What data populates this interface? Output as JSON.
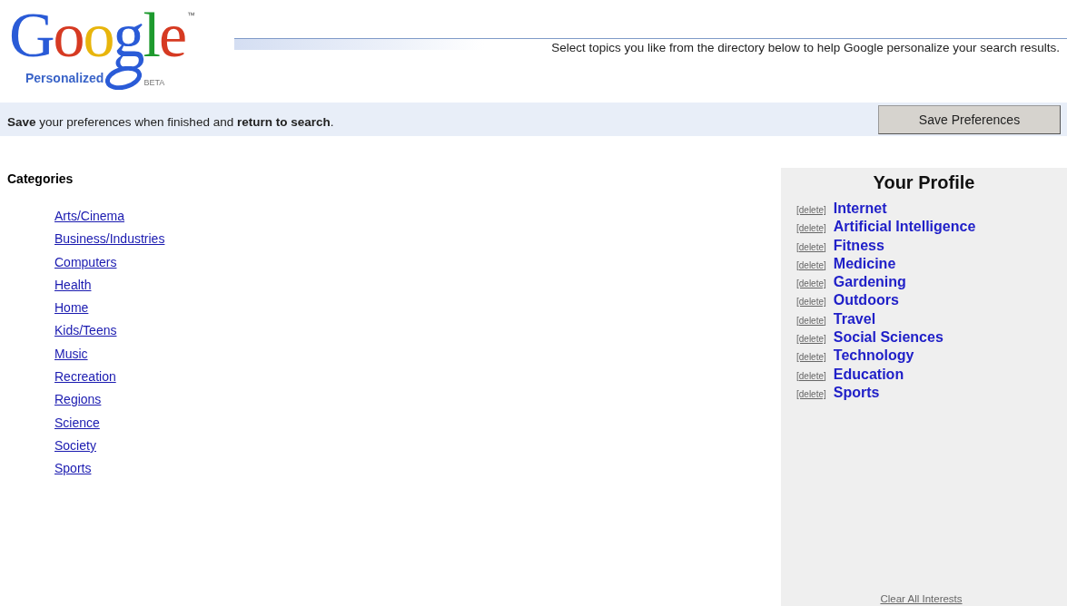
{
  "logo": {
    "wordmark": "Google",
    "trademark": "™",
    "tagline": "Personalized",
    "badge": "BETA"
  },
  "header": {
    "intro": "Select topics you like from the directory below to help Google personalize your search results."
  },
  "save_bar": {
    "message": "**Save** your preferences when finished and **return to search**.",
    "button": "Save Preferences"
  },
  "categories": {
    "title": "Categories",
    "items": [
      "Arts/Cinema",
      "Business/Industries",
      "Computers",
      "Health",
      "Home",
      "Kids/Teens",
      "Music",
      "Recreation",
      "Regions",
      "Science",
      "Society",
      "Sports"
    ]
  },
  "profile": {
    "title": "Your Profile",
    "interests": [
      {
        "delete": "[delete]",
        "name": "Internet"
      },
      {
        "delete": "[delete]",
        "name": "Artificial Intelligence"
      },
      {
        "delete": "[delete]",
        "name": "Fitness"
      },
      {
        "delete": "[delete]",
        "name": "Medicine"
      },
      {
        "delete": "[delete]",
        "name": "Gardening"
      },
      {
        "delete": "[delete]",
        "name": "Outdoors"
      },
      {
        "delete": "[delete]",
        "name": "Travel"
      },
      {
        "delete": "[delete]",
        "name": "Social Sciences"
      },
      {
        "delete": "[delete]",
        "name": "Technology"
      },
      {
        "delete": "[delete]",
        "name": "Education"
      },
      {
        "delete": "[delete]",
        "name": "Sports"
      }
    ],
    "clear": "Clear All Interests"
  }
}
